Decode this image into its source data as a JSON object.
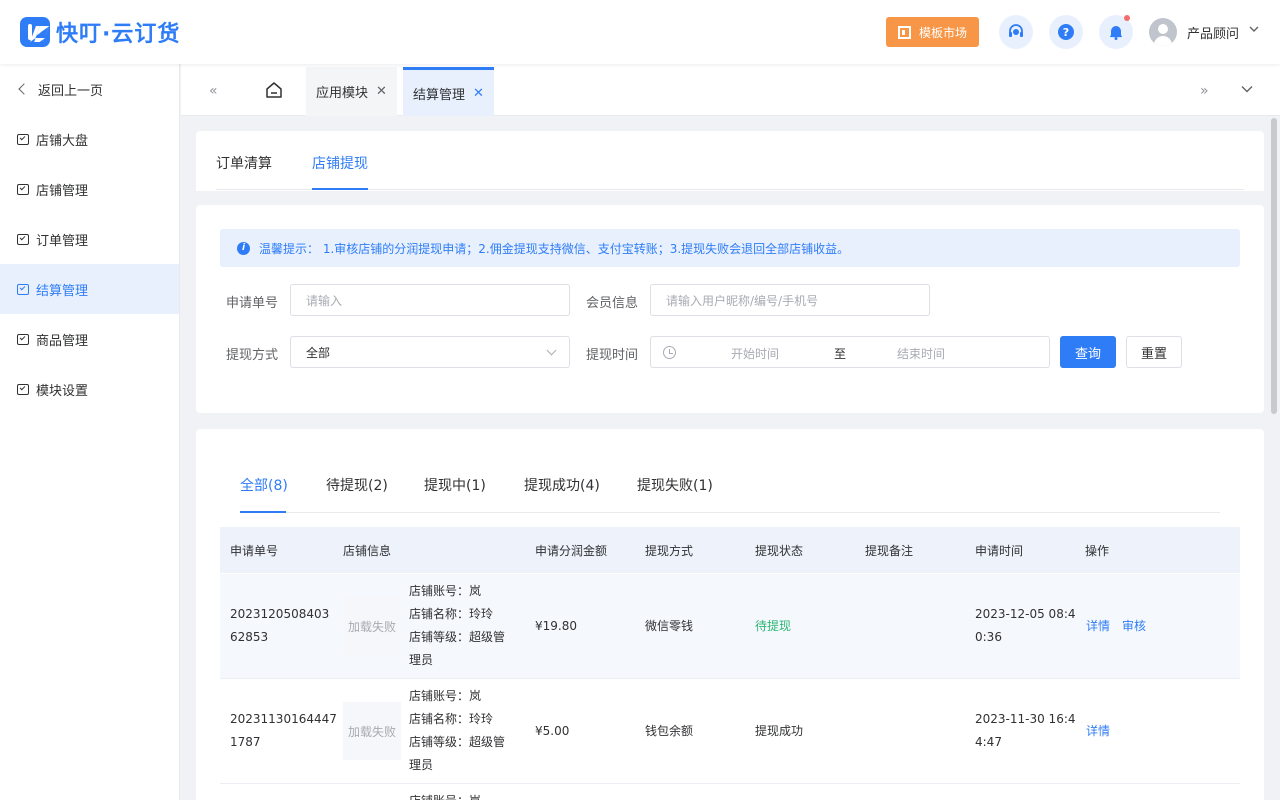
{
  "header": {
    "logo_text": "快叮·云订货",
    "template_market": "模板市场",
    "user_name": "产品顾问"
  },
  "sidebar": {
    "back": "返回上一页",
    "items": [
      {
        "label": "店铺大盘"
      },
      {
        "label": "店铺管理"
      },
      {
        "label": "订单管理"
      },
      {
        "label": "结算管理"
      },
      {
        "label": "商品管理"
      },
      {
        "label": "模块设置"
      }
    ]
  },
  "tabbar": {
    "tabs": [
      {
        "label": "应用模块"
      },
      {
        "label": "结算管理"
      }
    ]
  },
  "subtabs": [
    "订单清算",
    "店铺提现"
  ],
  "notice": "温馨提示： 1.审核店铺的分润提现申请；2.佣金提现支持微信、支付宝转账；3.提现失败会退回全部店铺收益。",
  "filters": {
    "apply_no_label": "申请单号",
    "apply_no_placeholder": "请输入",
    "member_label": "会员信息",
    "member_placeholder": "请输入用户昵称/编号/手机号",
    "method_label": "提现方式",
    "method_value": "全部",
    "time_label": "提现时间",
    "start_placeholder": "开始时间",
    "range_sep": "至",
    "end_placeholder": "结束时间",
    "query": "查询",
    "reset": "重置"
  },
  "status_tabs": [
    "全部(8)",
    "待提现(2)",
    "提现中(1)",
    "提现成功(4)",
    "提现失败(1)"
  ],
  "table": {
    "headers": [
      "申请单号",
      "店铺信息",
      "申请分润金额",
      "提现方式",
      "提现状态",
      "提现备注",
      "申请时间",
      "操作"
    ],
    "rows": [
      {
        "no_line1": "2023120508403",
        "no_line2": "62853",
        "img": "加载失败",
        "account": "店铺账号：岚",
        "name": "店铺名称：玲玲",
        "level": "店铺等级：超级管",
        "level2": "理员",
        "amount": "¥19.80",
        "method": "微信零钱",
        "status": "待提现",
        "time_line1": "2023-12-05 08:4",
        "time_line2": "0:36",
        "actions": [
          "详情",
          "审核"
        ]
      },
      {
        "no_line1": "20231130164447",
        "no_line2": "1787",
        "img": "加载失败",
        "account": "店铺账号：岚",
        "name": "店铺名称：玲玲",
        "level": "店铺等级：超级管",
        "level2": "理员",
        "amount": "¥5.00",
        "method": "钱包余额",
        "status": "提现成功",
        "time_line1": "2023-11-30 16:4",
        "time_line2": "4:47",
        "actions": [
          "详情"
        ]
      },
      {
        "account": "店铺账号：岚"
      }
    ]
  },
  "colors": {
    "primary": "#2f7df6",
    "orange": "#f79646",
    "success_green": "#2bb673"
  }
}
